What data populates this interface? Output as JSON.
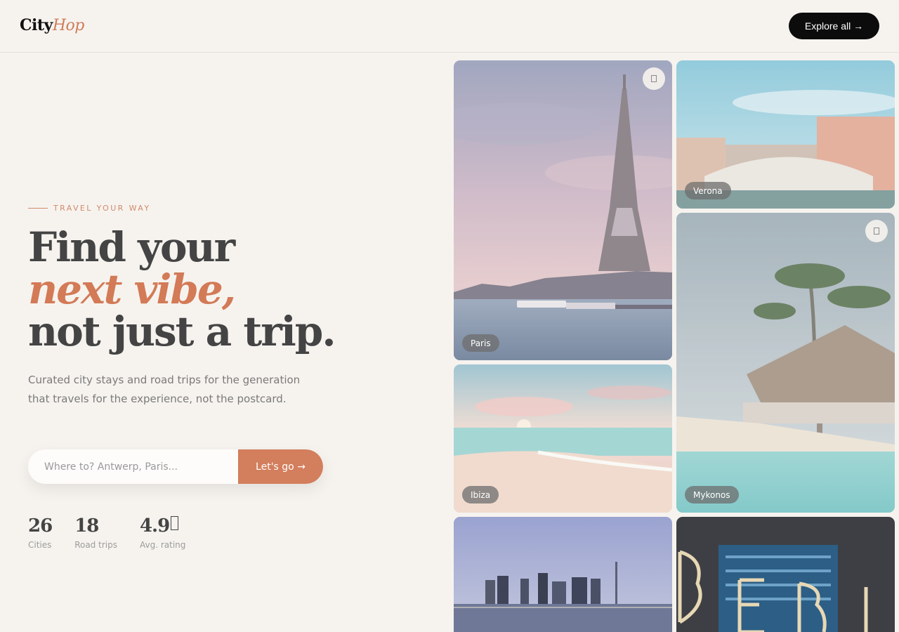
{
  "header": {
    "logo_city": "City",
    "logo_hop": "Hop",
    "explore_label": "Explore all →"
  },
  "hero": {
    "eyebrow": "TRAVEL YOUR WAY",
    "headline_line1": "Find your",
    "headline_line2": "next vibe,",
    "headline_line3": "not just a trip.",
    "lede": "Curated city stays and road trips for the generation that travels for the experience, not the postcard.",
    "search_placeholder": "Where to? Antwerp, Paris...",
    "search_button": "Let's go →"
  },
  "stats": [
    {
      "value": "26",
      "label": "Cities"
    },
    {
      "value": "18",
      "label": "Road trips"
    },
    {
      "value": "4.9",
      "label": "Avg. rating"
    }
  ],
  "destinations": [
    {
      "name": "Paris"
    },
    {
      "name": "Verona"
    },
    {
      "name": "Mykonos"
    },
    {
      "name": "Ibiza"
    }
  ],
  "icons": {
    "save": "bookmark-icon",
    "rating": "star-icon"
  },
  "colors": {
    "background": "#f6f3ef",
    "accent": "#d37e5c",
    "dark": "#0c0c0c",
    "text": "#444444"
  }
}
